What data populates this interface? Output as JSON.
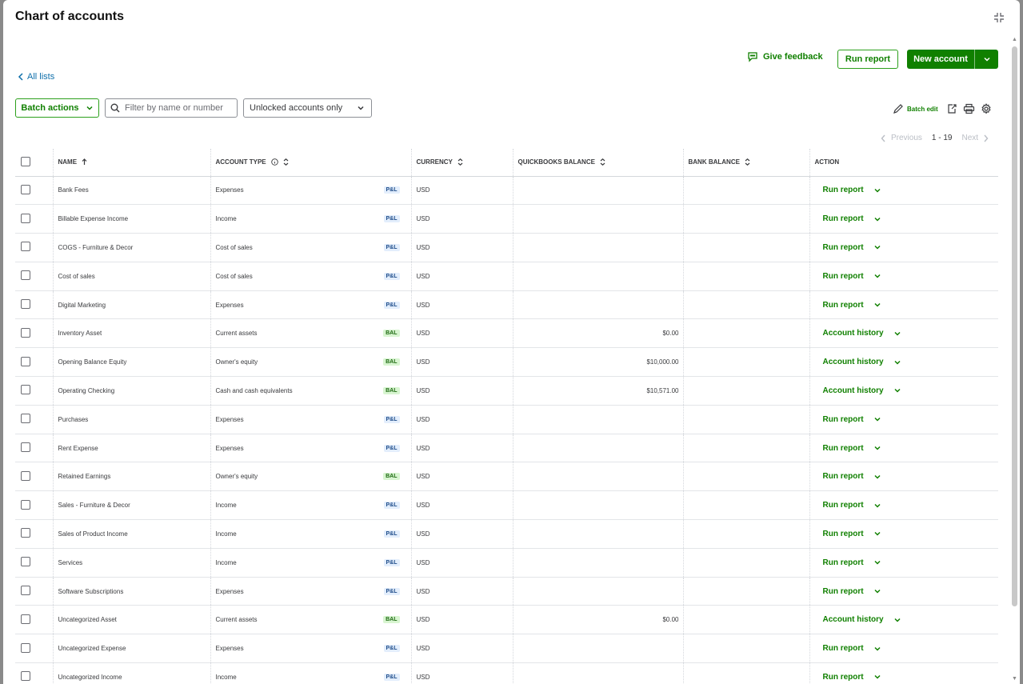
{
  "page": {
    "title": "Chart of accounts"
  },
  "header": {
    "feedback_label": "Give feedback",
    "run_report_label": "Run report",
    "new_account_label": "New account"
  },
  "nav": {
    "all_lists_label": "All lists"
  },
  "toolbar": {
    "batch_actions_label": "Batch actions",
    "filter_placeholder": "Filter by name or number",
    "filter_select_value": "Unlocked accounts only",
    "batch_edit_label": "Batch edit"
  },
  "pager": {
    "previous_label": "Previous",
    "range": "1 - 19",
    "next_label": "Next"
  },
  "table": {
    "columns": [
      "Name",
      "Account type",
      "Currency",
      "QuickBooks balance",
      "Bank balance",
      "Action"
    ],
    "rows": [
      {
        "name": "Bank Fees",
        "type": "Expenses",
        "badge": "P&L",
        "currency": "USD",
        "qb_balance": "",
        "bank_balance": "",
        "action": "Run report"
      },
      {
        "name": "Billable Expense Income",
        "type": "Income",
        "badge": "P&L",
        "currency": "USD",
        "qb_balance": "",
        "bank_balance": "",
        "action": "Run report"
      },
      {
        "name": "COGS - Furniture & Decor",
        "type": "Cost of sales",
        "badge": "P&L",
        "currency": "USD",
        "qb_balance": "",
        "bank_balance": "",
        "action": "Run report"
      },
      {
        "name": "Cost of sales",
        "type": "Cost of sales",
        "badge": "P&L",
        "currency": "USD",
        "qb_balance": "",
        "bank_balance": "",
        "action": "Run report"
      },
      {
        "name": "Digital Marketing",
        "type": "Expenses",
        "badge": "P&L",
        "currency": "USD",
        "qb_balance": "",
        "bank_balance": "",
        "action": "Run report"
      },
      {
        "name": "Inventory Asset",
        "type": "Current assets",
        "badge": "BAL",
        "currency": "USD",
        "qb_balance": "$0.00",
        "bank_balance": "",
        "action": "Account history"
      },
      {
        "name": "Opening Balance Equity",
        "type": "Owner's equity",
        "badge": "BAL",
        "currency": "USD",
        "qb_balance": "$10,000.00",
        "bank_balance": "",
        "action": "Account history"
      },
      {
        "name": "Operating Checking",
        "type": "Cash and cash equivalents",
        "badge": "BAL",
        "currency": "USD",
        "qb_balance": "$10,571.00",
        "bank_balance": "",
        "action": "Account history"
      },
      {
        "name": "Purchases",
        "type": "Expenses",
        "badge": "P&L",
        "currency": "USD",
        "qb_balance": "",
        "bank_balance": "",
        "action": "Run report"
      },
      {
        "name": "Rent Expense",
        "type": "Expenses",
        "badge": "P&L",
        "currency": "USD",
        "qb_balance": "",
        "bank_balance": "",
        "action": "Run report"
      },
      {
        "name": "Retained Earnings",
        "type": "Owner's equity",
        "badge": "BAL",
        "currency": "USD",
        "qb_balance": "",
        "bank_balance": "",
        "action": "Run report"
      },
      {
        "name": "Sales - Furniture & Decor",
        "type": "Income",
        "badge": "P&L",
        "currency": "USD",
        "qb_balance": "",
        "bank_balance": "",
        "action": "Run report"
      },
      {
        "name": "Sales of Product Income",
        "type": "Income",
        "badge": "P&L",
        "currency": "USD",
        "qb_balance": "",
        "bank_balance": "",
        "action": "Run report"
      },
      {
        "name": "Services",
        "type": "Income",
        "badge": "P&L",
        "currency": "USD",
        "qb_balance": "",
        "bank_balance": "",
        "action": "Run report"
      },
      {
        "name": "Software Subscriptions",
        "type": "Expenses",
        "badge": "P&L",
        "currency": "USD",
        "qb_balance": "",
        "bank_balance": "",
        "action": "Run report"
      },
      {
        "name": "Uncategorized Asset",
        "type": "Current assets",
        "badge": "BAL",
        "currency": "USD",
        "qb_balance": "$0.00",
        "bank_balance": "",
        "action": "Account history"
      },
      {
        "name": "Uncategorized Expense",
        "type": "Expenses",
        "badge": "P&L",
        "currency": "USD",
        "qb_balance": "",
        "bank_balance": "",
        "action": "Run report"
      },
      {
        "name": "Uncategorized Income",
        "type": "Income",
        "badge": "P&L",
        "currency": "USD",
        "qb_balance": "",
        "bank_balance": "",
        "action": "Run report"
      }
    ]
  },
  "colors": {
    "brand_green": "#108000",
    "link_blue": "#0d6eaa",
    "pl_badge": "#e3eefc",
    "bal_badge": "#d8f5d1"
  }
}
